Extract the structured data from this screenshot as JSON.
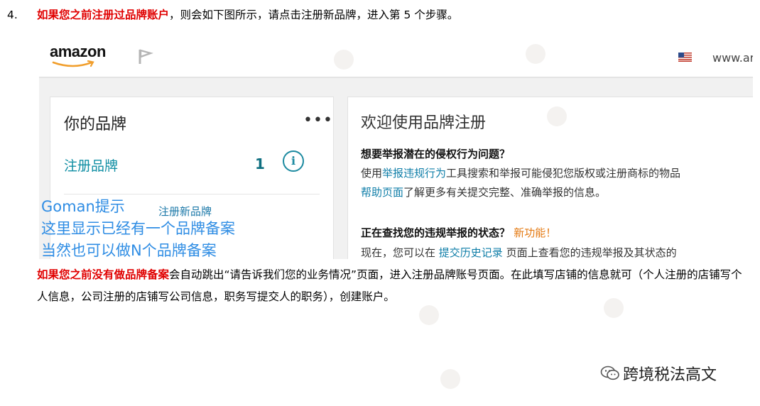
{
  "step": {
    "number": "4.",
    "highlight": "如果您之前注册过品牌账户",
    "text": "，则会如下图所示，请点击注册新品牌，进入第 5 个步骤。"
  },
  "screenshot": {
    "logo": "amazon",
    "url": "www.ar",
    "left_card": {
      "title": "你的品牌",
      "menu": "•••",
      "brand_link": "注册品牌",
      "brand_count": "1",
      "info": "i",
      "register_new": "注册新品牌"
    },
    "right_card": {
      "title": "欢迎使用品牌注册",
      "q1": "想要举报潜在的侵权行为问题？",
      "p1_pre": "使用",
      "p1_link": "举报违规行为",
      "p1_post": "工具搜索和举报可能侵犯您版权或注册商标的物品",
      "p2_link": "帮助页面",
      "p2_post": "了解更多有关提交完整、准确举报的信息。",
      "q2": "正在查找您的违规举报的状态？",
      "q2_new": "新功能！",
      "p3_pre": "现在，您可以在 ",
      "p3_link": "提交历史记录",
      "p3_post": " 页面上查看您的违规举报及其状态的"
    }
  },
  "annotation": {
    "line1": "Goman提示",
    "line2": "这里显示已经有一个品牌备案",
    "line3": "当然也可以做N个品牌备案"
  },
  "paragraph": {
    "highlight": "如果您之前没有做品牌备案",
    "text": "会自动跳出“请告诉我们您的业务情况”页面，进入注册品牌账号页面。在此填写店铺的信息就可（个人注册的店铺写个人信息，公司注册的店铺写公司信息，职务写提交人的职务），创建账户。"
  },
  "footer": {
    "icon": "wechat-icon",
    "text": "跨境税法高文"
  },
  "colors": {
    "highlight": "#e00000",
    "link": "#0f8ea3",
    "annotation": "#2f8de4",
    "new_feature": "#e47911"
  }
}
